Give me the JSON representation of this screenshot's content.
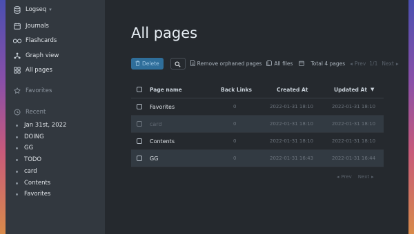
{
  "sidebar": {
    "graph_name": "Logseq",
    "nav": [
      {
        "label": "Journals",
        "icon": "calendar-icon"
      },
      {
        "label": "Flashcards",
        "icon": "infinity-icon"
      },
      {
        "label": "Graph view",
        "icon": "graph-icon"
      },
      {
        "label": "All pages",
        "icon": "pages-icon"
      }
    ],
    "favorites_label": "Favorites",
    "recent_label": "Recent",
    "recent_items": [
      "Jan 31st, 2022",
      "DOING",
      "GG",
      "TODO",
      "card",
      "Contents",
      "Favorites"
    ]
  },
  "main": {
    "title": "All pages",
    "toolbar": {
      "delete_label": "Delete",
      "remove_orphaned_label": "Remove orphaned pages",
      "all_files_label": "All files",
      "total_label": "Total 4 pages",
      "prev_label": "Prev",
      "page_indicator": "1/1",
      "next_label": "Next"
    },
    "table": {
      "headers": {
        "name": "Page name",
        "backlinks": "Back Links",
        "created": "Created At",
        "updated": "Updated At"
      },
      "rows": [
        {
          "name": "Favorites",
          "backlinks": "0",
          "created": "2022-01-31 18:10",
          "updated": "2022-01-31 18:10"
        },
        {
          "name": "card",
          "backlinks": "0",
          "created": "2022-01-31 18:10",
          "updated": "2022-01-31 18:10"
        },
        {
          "name": "Contents",
          "backlinks": "0",
          "created": "2022-01-31 18:10",
          "updated": "2022-01-31 18:10"
        },
        {
          "name": "GG",
          "backlinks": "0",
          "created": "2022-01-31 16:43",
          "updated": "2022-01-31 16:44"
        }
      ]
    },
    "bottom_pager": {
      "prev_label": "Prev",
      "next_label": "Next"
    }
  },
  "colors": {
    "accent": "#2f6e9a",
    "sidebar_bg": "#32383f",
    "main_bg": "#25292e"
  }
}
